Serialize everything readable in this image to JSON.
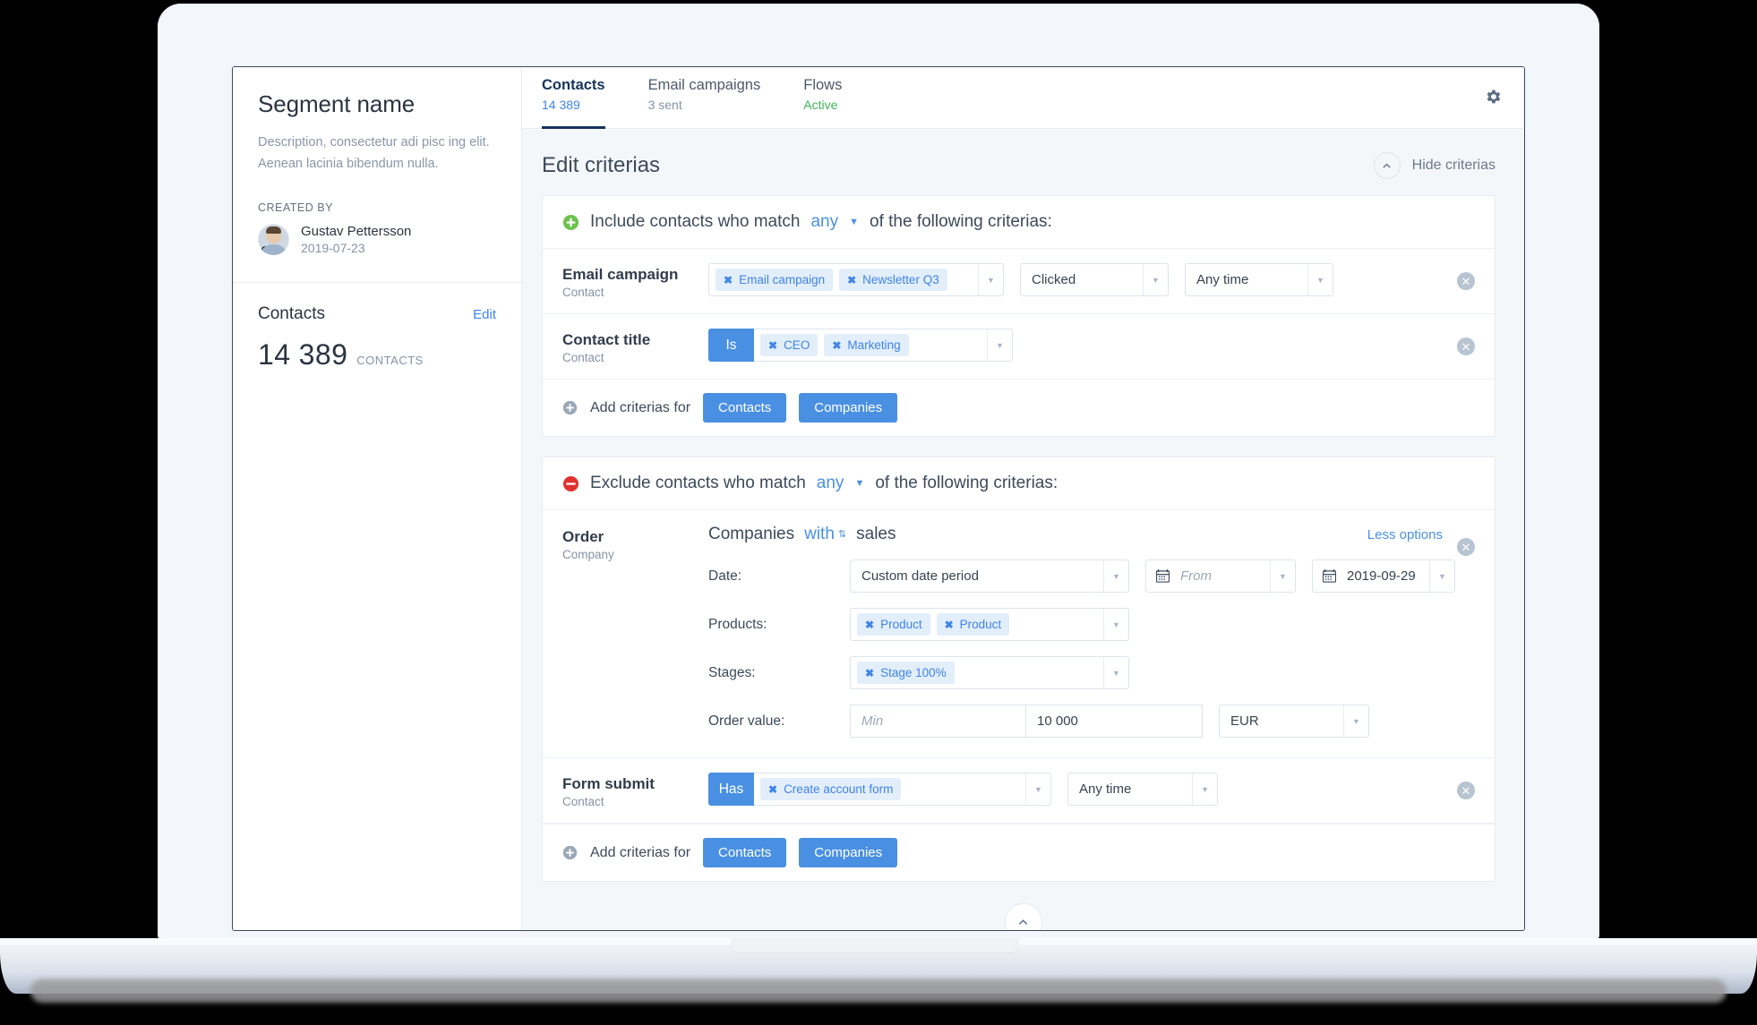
{
  "segment": {
    "title": "Segment name",
    "description": "Description, consectetur adi pisc ing elit. Aenean lacinia bibendum nulla.",
    "created_by_label": "CREATED BY",
    "creator_name": "Gustav Pettersson",
    "creator_date": "2019-07-23",
    "contacts_label": "Contacts",
    "edit_label": "Edit",
    "contacts_count": "14 389",
    "contacts_unit": "CONTACTS"
  },
  "tabs": [
    {
      "label": "Contacts",
      "sub": "14 389",
      "active": true
    },
    {
      "label": "Email campaigns",
      "sub": "3 sent",
      "active": false
    },
    {
      "label": "Flows",
      "sub": "Active",
      "active": false
    }
  ],
  "header": {
    "title": "Edit criterias",
    "hide_criterias": "Hide criterias",
    "gear_icon": "gear-icon"
  },
  "include": {
    "text_before": "Include contacts who match",
    "match": "any",
    "text_after": "of the following criterias:",
    "icon": "plus-circle-green-icon",
    "rows": [
      {
        "name": "Email campaign",
        "sub": "Contact",
        "tags": [
          "Email campaign",
          "Newsletter Q3"
        ],
        "action": "Clicked",
        "time": "Any time"
      },
      {
        "name": "Contact title",
        "sub": "Contact",
        "operator": "Is",
        "tags": [
          "CEO",
          "Marketing"
        ]
      }
    ],
    "add_label": "Add criterias for",
    "add_buttons": [
      "Contacts",
      "Companies"
    ]
  },
  "exclude": {
    "text_before": "Exclude contacts who match",
    "match": "any",
    "text_after": "of the following criterias:",
    "icon": "minus-circle-red-icon",
    "order": {
      "name": "Order",
      "sub": "Company",
      "headline_a": "Companies",
      "headline_link": "with",
      "headline_b": "sales",
      "less_options": "Less options",
      "date_label": "Date:",
      "date_period": "Custom date period",
      "date_from_placeholder": "From",
      "date_to": "2019-09-29",
      "products_label": "Products:",
      "products": [
        "Product",
        "Product"
      ],
      "stages_label": "Stages:",
      "stages": [
        "Stage 100%"
      ],
      "order_value_label": "Order value:",
      "order_min_placeholder": "Min",
      "order_max": "10 000",
      "currency": "EUR"
    },
    "form_submit": {
      "name": "Form submit",
      "sub": "Contact",
      "operator": "Has",
      "tags": [
        "Create account form"
      ],
      "time": "Any time"
    },
    "add_label": "Add criterias for",
    "add_buttons": [
      "Contacts",
      "Companies"
    ]
  },
  "colors": {
    "accent_blue": "#4a90e2",
    "link_blue": "#3f84e8",
    "tab_active": "#16335c",
    "green": "#43b15e",
    "include_green": "#6cc24a",
    "exclude_red": "#e03030",
    "tag_bg": "#e3eefb"
  }
}
